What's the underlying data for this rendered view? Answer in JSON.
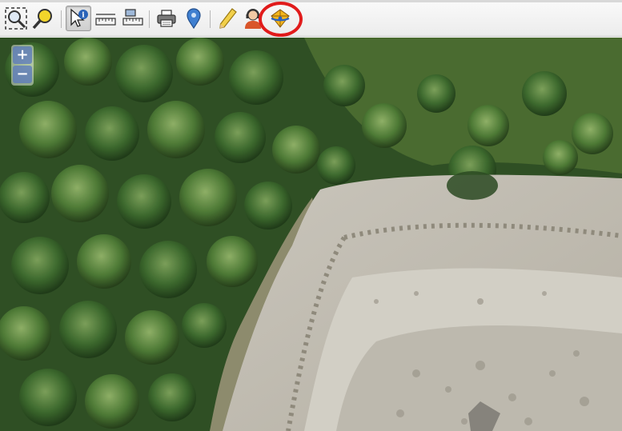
{
  "toolbar": {
    "tools": [
      {
        "name": "zoom-full-extent",
        "icon": "zoom-extent-icon"
      },
      {
        "name": "zoom-in-tool",
        "icon": "magnifier-yellow-icon"
      },
      {
        "name": "identify-tool",
        "icon": "cursor-info-icon",
        "active": true
      },
      {
        "name": "measure-line",
        "icon": "ruler-icon"
      },
      {
        "name": "measure-area",
        "icon": "ruler-area-icon"
      },
      {
        "name": "print",
        "icon": "printer-icon"
      },
      {
        "name": "place-marker",
        "icon": "pin-icon"
      },
      {
        "name": "edit-pencil",
        "icon": "pencil-icon"
      },
      {
        "name": "user-profile",
        "icon": "user-headset-icon"
      },
      {
        "name": "3d-view",
        "icon": "3d-globe-icon",
        "highlighted": true
      }
    ],
    "highlight_color": "#e11b1b"
  },
  "map": {
    "zoom_in_label": "+",
    "zoom_out_label": "−",
    "zoom_button_color": "#5a78be"
  }
}
